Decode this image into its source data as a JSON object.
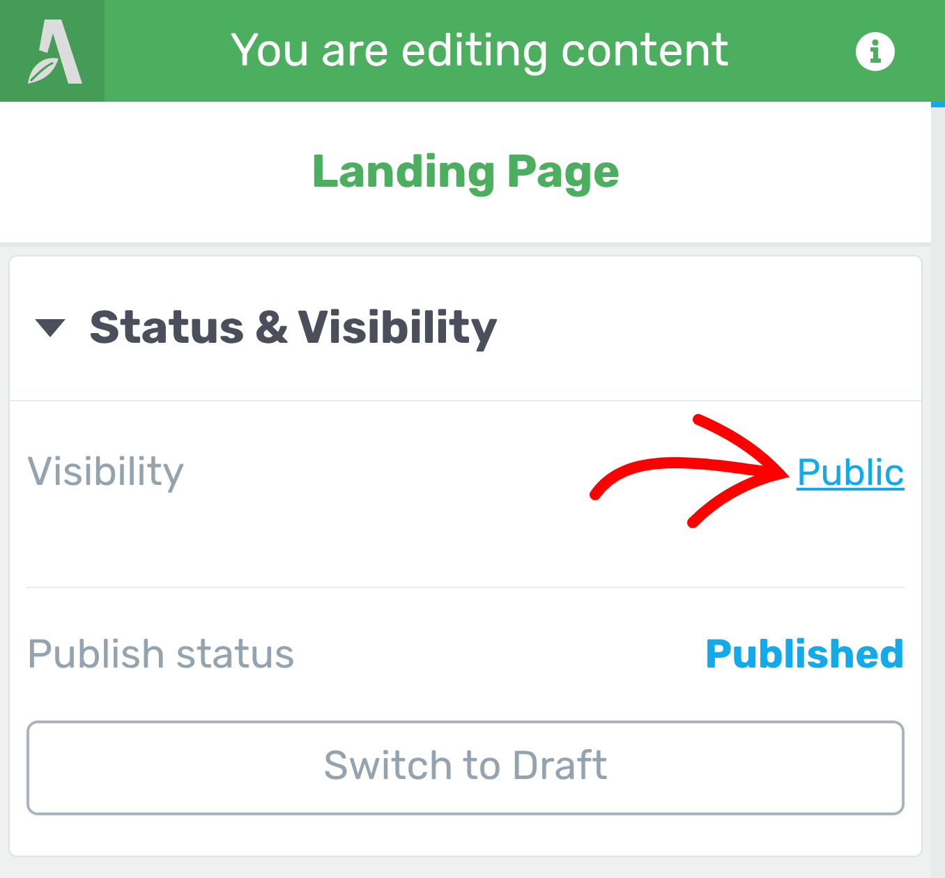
{
  "header": {
    "title": "You are editing content"
  },
  "page_title": "Landing Page",
  "section": {
    "title": "Status & Visibility",
    "expanded": true,
    "rows": [
      {
        "label": "Visibility",
        "value": "Public",
        "kind": "link"
      },
      {
        "label": "Publish status",
        "value": "Published",
        "kind": "status"
      }
    ],
    "button": "Switch to Draft"
  }
}
